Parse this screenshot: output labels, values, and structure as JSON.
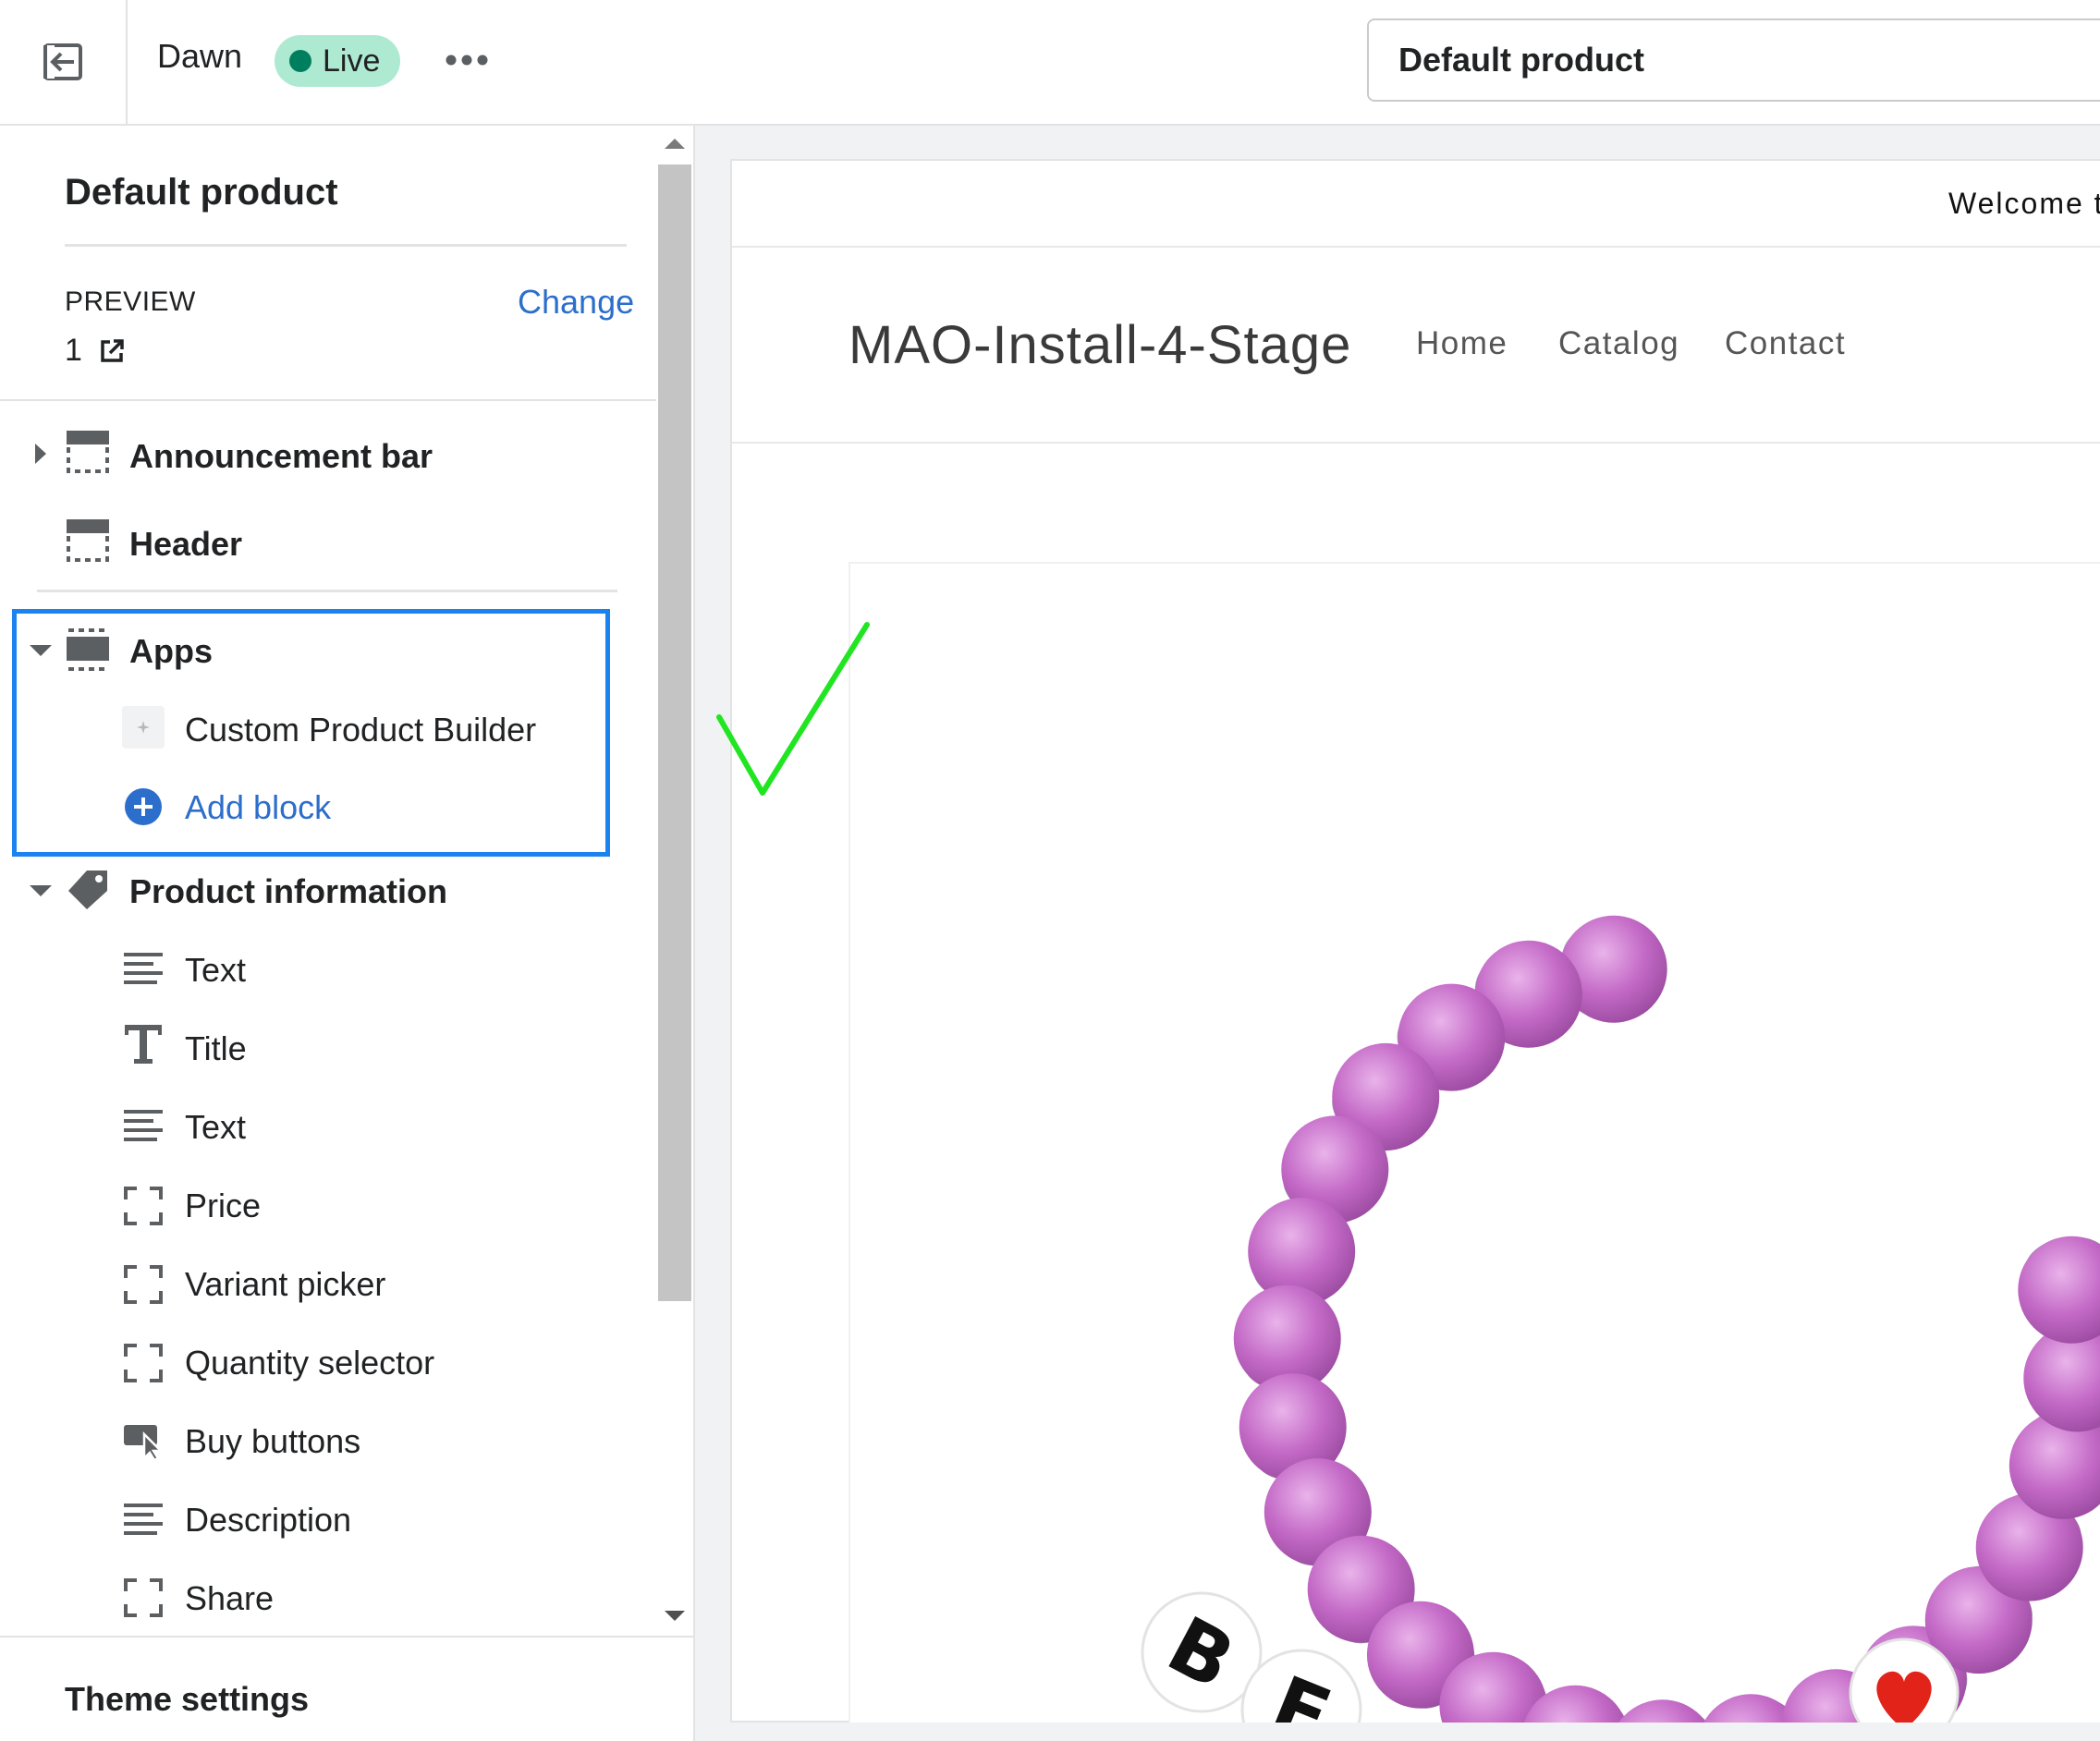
{
  "topbar": {
    "theme_name": "Dawn",
    "status_badge": "Live",
    "template_select_value": "Default product"
  },
  "sidebar": {
    "title": "Default product",
    "preview_label": "PREVIEW",
    "change_label": "Change",
    "preview_value": "1",
    "sections": {
      "announcement_bar": "Announcement bar",
      "header": "Header",
      "apps": "Apps",
      "apps_blocks": [
        "Custom Product Builder"
      ],
      "add_block": "Add block",
      "product_information": "Product information",
      "product_blocks": [
        "Text",
        "Title",
        "Text",
        "Price",
        "Variant picker",
        "Quantity selector",
        "Buy buttons",
        "Description",
        "Share"
      ]
    },
    "theme_settings": "Theme settings"
  },
  "preview": {
    "announcement": "Welcome t",
    "store_name": "MAO-Install-4-Stage",
    "nav": [
      "Home",
      "Catalog",
      "Contact"
    ]
  },
  "colors": {
    "accent": "#2c6ecb",
    "highlight_border": "#1a83f0",
    "live_badge": "#aee9d1",
    "checkmark": "#22e522",
    "bead": "#c46ac7"
  }
}
